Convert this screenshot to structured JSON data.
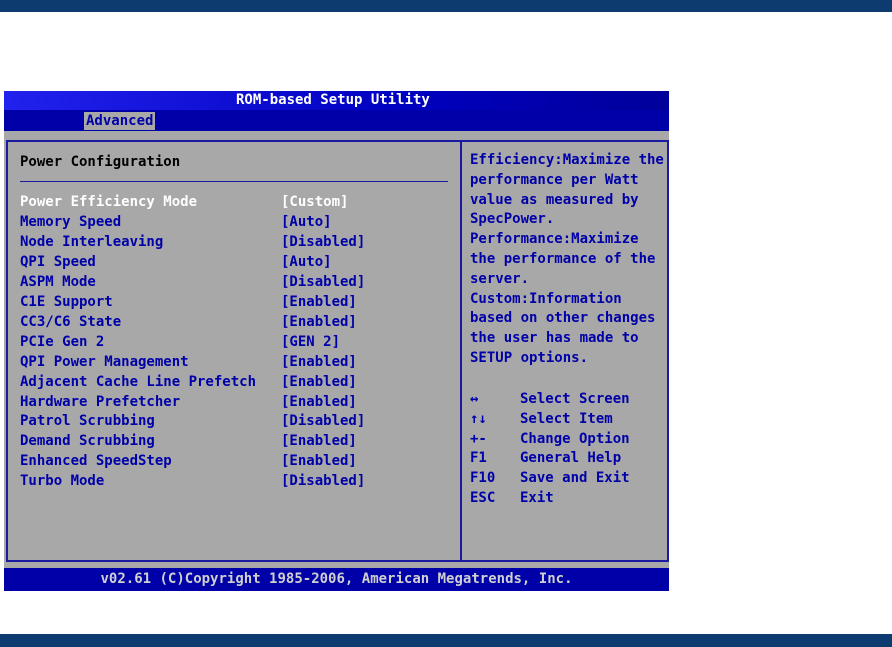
{
  "title": "ROM-based Setup Utility",
  "tab": "Advanced",
  "heading": "Power Configuration",
  "items": [
    {
      "label": "Power Efficiency Mode",
      "value": "[Custom]"
    },
    {
      "label": "Memory Speed",
      "value": "[Auto]"
    },
    {
      "label": "Node Interleaving",
      "value": "[Disabled]"
    },
    {
      "label": "QPI Speed",
      "value": "[Auto]"
    },
    {
      "label": "ASPM Mode",
      "value": "[Disabled]"
    },
    {
      "label": "C1E Support",
      "value": "[Enabled]"
    },
    {
      "label": "CC3/C6 State",
      "value": "[Enabled]"
    },
    {
      "label": "PCIe Gen 2",
      "value": "[GEN 2]"
    },
    {
      "label": "QPI Power Management",
      "value": "[Enabled]"
    },
    {
      "label": "Adjacent Cache Line Prefetch",
      "value": "[Enabled]"
    },
    {
      "label": "Hardware Prefetcher",
      "value": "[Enabled]"
    },
    {
      "label": "Patrol Scrubbing",
      "value": "[Disabled]"
    },
    {
      "label": "Demand Scrubbing",
      "value": "[Enabled]"
    },
    {
      "label": "Enhanced SpeedStep",
      "value": "[Enabled]"
    },
    {
      "label": "Turbo Mode",
      "value": "[Disabled]"
    }
  ],
  "help": "Efficiency:Maximize the performance per Watt value as measured by SpecPower. Performance:Maximize the performance of the server. Custom:Information based on other changes the user has made to SETUP options.",
  "keys": [
    {
      "key": "↔",
      "desc": "Select Screen"
    },
    {
      "key": "↑↓",
      "desc": "Select Item"
    },
    {
      "key": "+-",
      "desc": "Change Option"
    },
    {
      "key": "F1",
      "desc": "General Help"
    },
    {
      "key": "F10",
      "desc": "Save and Exit"
    },
    {
      "key": "ESC",
      "desc": "Exit"
    }
  ],
  "footer": "v02.61 (C)Copyright 1985-2006, American Megatrends, Inc."
}
